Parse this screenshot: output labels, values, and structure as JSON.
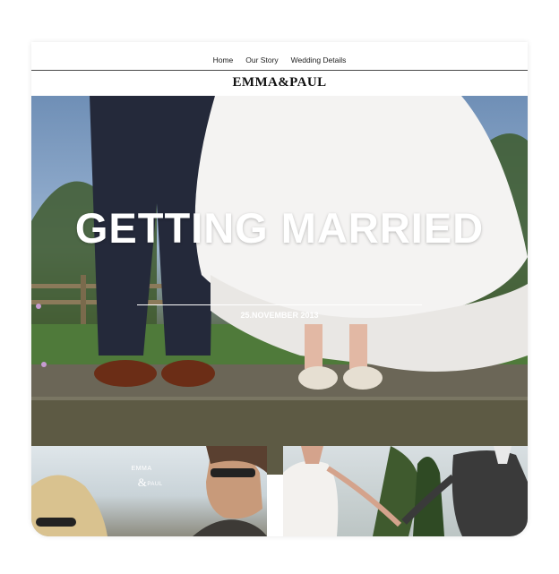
{
  "nav": {
    "items": [
      {
        "label": "Home"
      },
      {
        "label": "Our Story"
      },
      {
        "label": "Wedding Details"
      }
    ]
  },
  "brand": {
    "logo": "EMMA&PAUL"
  },
  "hero": {
    "title": "GETTING MARRIED",
    "date": "25.NOVEMBER 2013"
  },
  "thumbnails": {
    "first": {
      "names_line1": "EMMA",
      "names_amp": "&",
      "names_line2": "PAUL"
    }
  },
  "colors": {
    "text": "#222222",
    "hero_text": "#ffffff",
    "rule": "#4a4a4a"
  }
}
